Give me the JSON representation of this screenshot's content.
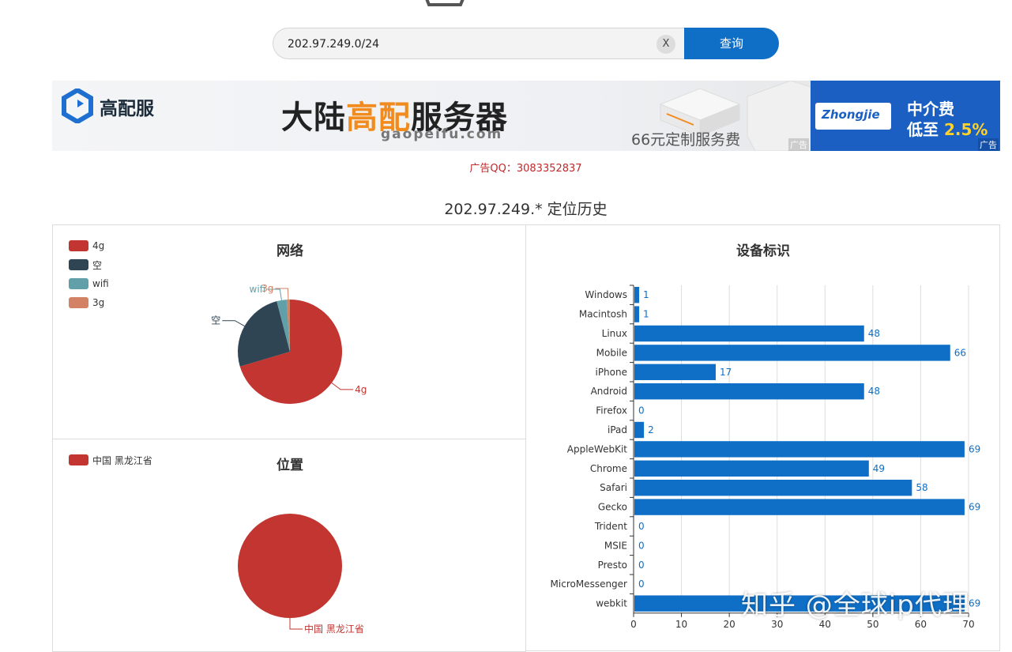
{
  "search": {
    "value": "202.97.249.0/24",
    "clear_label": "X",
    "button_label": "查询"
  },
  "ads": {
    "banner1": {
      "brand": "高配服",
      "headline_before": "大陆",
      "headline_highlight": "高配",
      "headline_after": "服务器",
      "domain": "gaopeifu.com",
      "price": "66元定制服务费",
      "ad_mark": "广告"
    },
    "banner2": {
      "logo_text": "Zhongjie",
      "line1": "中介费",
      "line2_prefix": "低至",
      "line2_value": "2.5%",
      "ad_mark": "广告"
    },
    "qq": "广告QQ：3083352837"
  },
  "page_title": "202.97.249.* 定位历史",
  "charts": {
    "network": {
      "title": "网络",
      "legend": [
        {
          "label": "4g",
          "color": "#c23531"
        },
        {
          "label": "空",
          "color": "#2f4554"
        },
        {
          "label": "wifi",
          "color": "#61a0a8"
        },
        {
          "label": "3g",
          "color": "#d48265"
        }
      ]
    },
    "location": {
      "title": "位置",
      "legend": [
        {
          "label": "中国 黑龙江省",
          "color": "#c23531"
        }
      ]
    },
    "device": {
      "title": "设备标识"
    }
  },
  "chart_data": [
    {
      "type": "pie",
      "title": "网络",
      "labels": [
        "4g",
        "空",
        "wifi",
        "3g"
      ],
      "values": [
        69,
        25,
        3,
        1
      ],
      "colors": [
        "#c23531",
        "#2f4554",
        "#61a0a8",
        "#d48265"
      ],
      "legend": "top-left"
    },
    {
      "type": "pie",
      "title": "位置",
      "labels": [
        "中国 黑龙江省"
      ],
      "values": [
        69
      ],
      "colors": [
        "#c23531"
      ],
      "legend": "top-left"
    },
    {
      "type": "bar",
      "orientation": "horizontal",
      "title": "设备标识",
      "categories": [
        "Windows",
        "Macintosh",
        "Linux",
        "Mobile",
        "iPhone",
        "Android",
        "Firefox",
        "iPad",
        "AppleWebKit",
        "Chrome",
        "Safari",
        "Gecko",
        "Trident",
        "MSIE",
        "Presto",
        "MicroMessenger",
        "webkit"
      ],
      "values": [
        1,
        1,
        48,
        66,
        17,
        48,
        0,
        2,
        69,
        49,
        58,
        69,
        0,
        0,
        0,
        0,
        69
      ],
      "xlim": [
        0,
        70
      ],
      "xticks": [
        0,
        10,
        20,
        30,
        40,
        50,
        60,
        70
      ],
      "color": "#0f6fc6",
      "grid": true
    }
  ],
  "watermark": "知乎 @全球ip代理"
}
